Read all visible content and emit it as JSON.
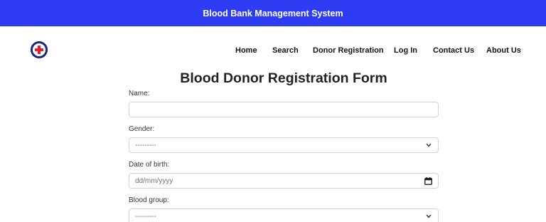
{
  "header": {
    "title": "Blood Bank Management System",
    "bar_color": "#2e3df4"
  },
  "nav": {
    "logo": "red-cross-logo-icon",
    "items": [
      {
        "label": "Home"
      },
      {
        "label": "Search"
      },
      {
        "label": "Donor Registration"
      },
      {
        "label": "Log In"
      },
      {
        "label": "Contact Us"
      },
      {
        "label": "About Us"
      }
    ]
  },
  "form": {
    "title": "Blood Donor Registration Form",
    "fields": {
      "name": {
        "label": "Name:",
        "value": ""
      },
      "gender": {
        "label": "Gender:",
        "selected": "---------",
        "icon": "chevron-down-icon"
      },
      "dob": {
        "label": "Date of birth:",
        "placeholder": "dd/mm/yyyy",
        "icon": "calendar-icon"
      },
      "blood_group": {
        "label": "Blood group:",
        "selected": "---------",
        "icon": "chevron-down-icon"
      }
    }
  },
  "colors": {
    "accent_blue": "#2e3df4",
    "logo_red": "#e0202a"
  }
}
